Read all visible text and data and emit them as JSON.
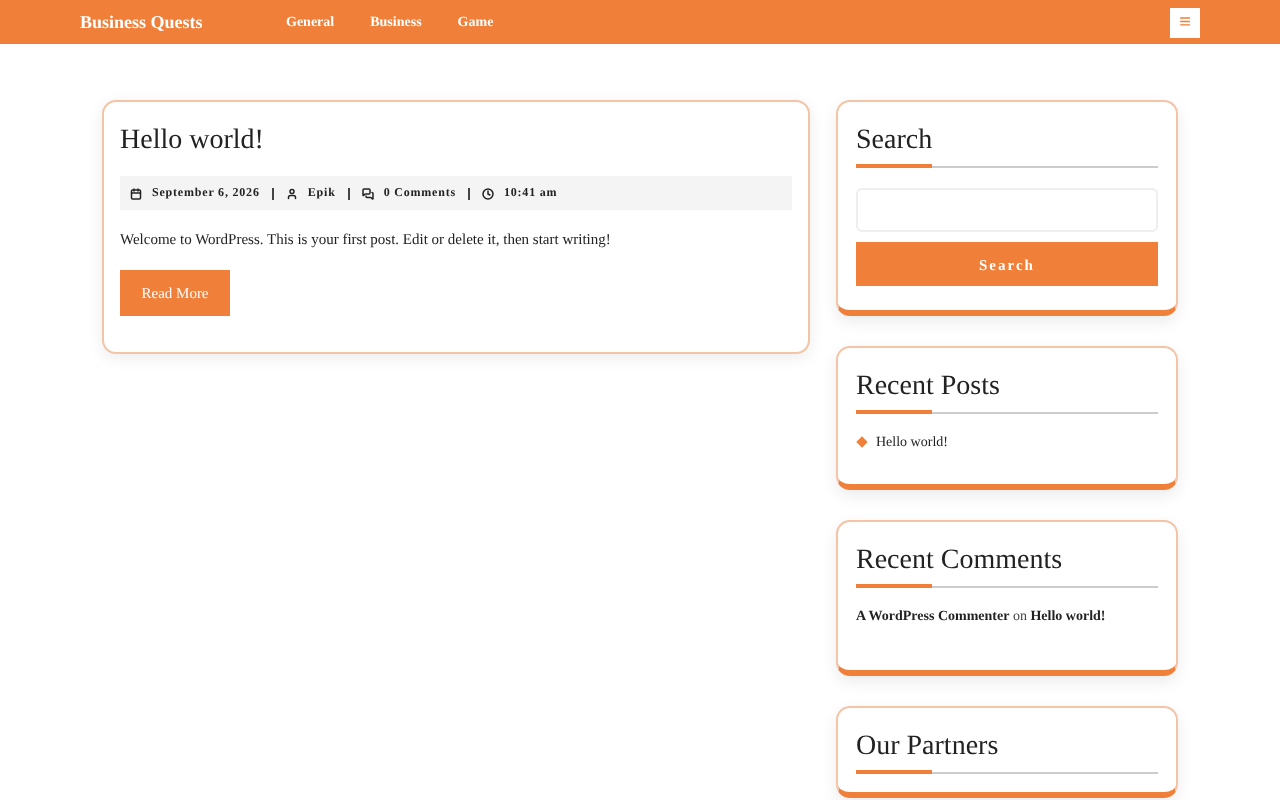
{
  "header": {
    "site_title": "Business Quests",
    "nav": [
      "General",
      "Business",
      "Game"
    ],
    "menu_button": "≡"
  },
  "post": {
    "title": "Hello world!",
    "meta": [
      {
        "kind": "date",
        "text": "September 6, 2026"
      },
      {
        "kind": "author",
        "text": "Epik"
      },
      {
        "kind": "comments",
        "text": "0 Comments"
      },
      {
        "kind": "time",
        "text": "10:41 am"
      }
    ],
    "excerpt": "Welcome to WordPress. This is your first post. Edit or delete it, then start writing!",
    "button": "Read More"
  },
  "sidebar": [
    {
      "kind": "search",
      "title": "Search",
      "button": "Search"
    },
    {
      "kind": "posts",
      "title": "Recent Posts",
      "items": [
        "Hello world!"
      ]
    },
    {
      "kind": "comments",
      "title": "Recent Comments",
      "items": [
        {
          "author": "A WordPress Commenter",
          "connector": "on",
          "post": "Hello world!"
        }
      ]
    },
    {
      "kind": "partners",
      "title": "Our Partners"
    }
  ]
}
